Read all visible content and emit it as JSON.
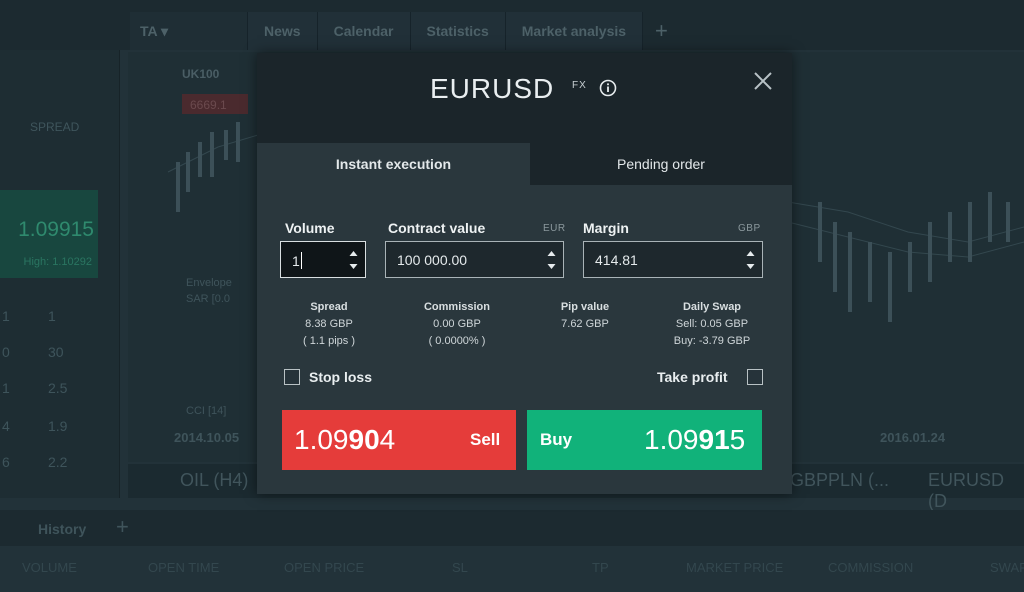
{
  "background": {
    "tabs": [
      "TA",
      "News",
      "Calendar",
      "Statistics",
      "Market analysis"
    ],
    "left_panel": {
      "spread_label": "SPREAD",
      "price": "1.09915",
      "high": "High: 1.10292",
      "rows": [
        [
          "1",
          "1"
        ],
        [
          "0",
          "30"
        ],
        [
          "1",
          "2.5"
        ],
        [
          "4",
          "1.9"
        ],
        [
          "6",
          "2.2"
        ]
      ]
    },
    "chart": {
      "symbol": "UK100",
      "price_tag": "6669.1",
      "indicator1": "Envelope",
      "indicator2": "SAR [0.0",
      "indicator3": "CCI [14]",
      "date_left": "2014.10.05",
      "date_right": "2016.01.24"
    },
    "bottom_tabs": [
      "OIL (H4)",
      "GBPPLN (...",
      "EURUSD (D"
    ],
    "history_label": "History",
    "columns": [
      "VOLUME",
      "OPEN TIME",
      "OPEN PRICE",
      "SL",
      "TP",
      "MARKET PRICE",
      "COMMISSION",
      "SWAP"
    ]
  },
  "modal": {
    "symbol": "EURUSD",
    "symbol_type": "FX",
    "tabs": {
      "instant": "Instant execution",
      "pending": "Pending order"
    },
    "volume": {
      "label": "Volume",
      "value": "1"
    },
    "contract_value": {
      "label": "Contract value",
      "currency": "EUR",
      "value": "100 000.00"
    },
    "margin": {
      "label": "Margin",
      "currency": "GBP",
      "value": "414.81"
    },
    "spread": {
      "label": "Spread",
      "line1": "8.38 GBP",
      "line2": "( 1.1 pips )"
    },
    "commission": {
      "label": "Commission",
      "line1": "0.00 GBP",
      "line2": "( 0.0000% )"
    },
    "pip_value": {
      "label": "Pip value",
      "line1": "7.62 GBP"
    },
    "daily_swap": {
      "label": "Daily Swap",
      "line1": "Sell: 0.05 GBP",
      "line2": "Buy: -3.79 GBP"
    },
    "stop_loss": {
      "label": "Stop loss",
      "checked": false
    },
    "take_profit": {
      "label": "Take profit",
      "checked": false
    },
    "sell": {
      "label": "Sell",
      "price_prefix": "1.09",
      "price_big": "90",
      "price_suffix": "4"
    },
    "buy": {
      "label": "Buy",
      "price_prefix": "1.09",
      "price_big": "91",
      "price_suffix": "5"
    }
  },
  "colors": {
    "sell": "#e53c3a",
    "buy": "#11b27a",
    "modal_bg": "#2a373d",
    "header_bg": "#1b252a"
  }
}
